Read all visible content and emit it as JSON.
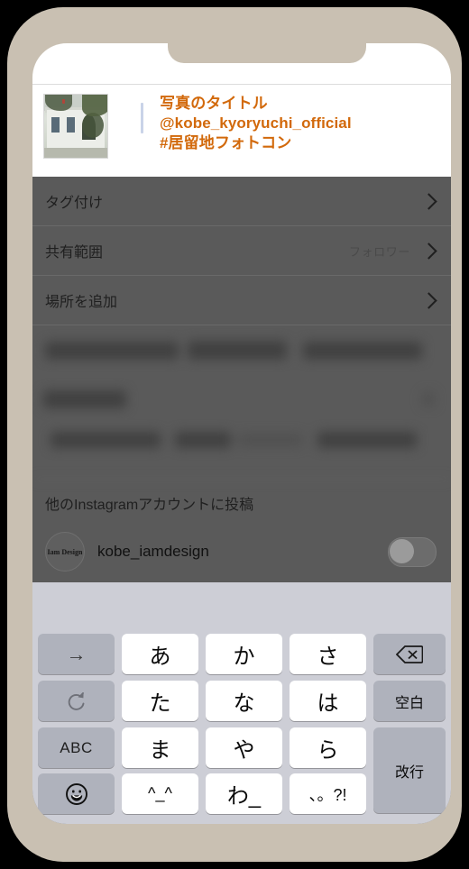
{
  "device": {
    "frame_color": "#C9C0B2",
    "screen_bg": "#FFFFFF"
  },
  "caption": {
    "accent_color": "#D2690B",
    "thumbnail_alt": "photo-thumbnail",
    "lines": [
      "写真のタイトル",
      "@kobe_kyoryuchi_official",
      "#居留地フォトコン"
    ]
  },
  "options": {
    "overlay_color": "#5A5A5A",
    "rows": [
      {
        "label": "タグ付け",
        "value": "",
        "chevron": true
      },
      {
        "label": "共有範囲",
        "value": "フォロワー",
        "chevron": true
      },
      {
        "label": "場所を追加",
        "value": "",
        "chevron": true
      }
    ],
    "section_title": "他のInstagramアカウントに投稿",
    "account": {
      "avatar_label": "Iam Design",
      "name": "kobe_iamdesign",
      "toggle_state": "off"
    }
  },
  "keyboard": {
    "bg_color": "#CDCED6",
    "char_key_color": "#FFFFFF",
    "fn_key_color": "#AFB2BC",
    "rows": [
      [
        {
          "label": "→",
          "icon": "arrow-right-icon",
          "type": "fn",
          "name": "key-cursor-right"
        },
        {
          "label": "あ",
          "icon": "",
          "type": "char",
          "name": "key-a-row"
        },
        {
          "label": "か",
          "icon": "",
          "type": "char",
          "name": "key-ka-row"
        },
        {
          "label": "さ",
          "icon": "",
          "type": "char",
          "name": "key-sa-row"
        },
        {
          "label": "",
          "icon": "backspace-icon",
          "type": "fn",
          "name": "key-backspace"
        }
      ],
      [
        {
          "label": "",
          "icon": "undo-icon",
          "type": "fn",
          "name": "key-undo"
        },
        {
          "label": "た",
          "icon": "",
          "type": "char",
          "name": "key-ta-row"
        },
        {
          "label": "な",
          "icon": "",
          "type": "char",
          "name": "key-na-row"
        },
        {
          "label": "は",
          "icon": "",
          "type": "char",
          "name": "key-ha-row"
        },
        {
          "label": "空白",
          "icon": "",
          "type": "fn",
          "name": "key-space"
        }
      ],
      [
        {
          "label": "ABC",
          "icon": "abc-icon",
          "type": "fn",
          "name": "key-abc"
        },
        {
          "label": "ま",
          "icon": "",
          "type": "char",
          "name": "key-ma-row"
        },
        {
          "label": "や",
          "icon": "",
          "type": "char",
          "name": "key-ya-row"
        },
        {
          "label": "ら",
          "icon": "",
          "type": "char",
          "name": "key-ra-row"
        },
        {
          "label": "改行",
          "icon": "",
          "type": "fn",
          "name": "key-return"
        }
      ],
      [
        {
          "label": "",
          "icon": "emoji-icon",
          "type": "fn",
          "name": "key-emoji"
        },
        {
          "label": "^_^",
          "icon": "",
          "type": "char",
          "name": "key-kaomoji"
        },
        {
          "label": "わ_",
          "icon": "",
          "type": "char",
          "name": "key-wa-row"
        },
        {
          "label": "、。?!",
          "icon": "",
          "type": "char",
          "name": "key-punctuation"
        }
      ]
    ]
  }
}
